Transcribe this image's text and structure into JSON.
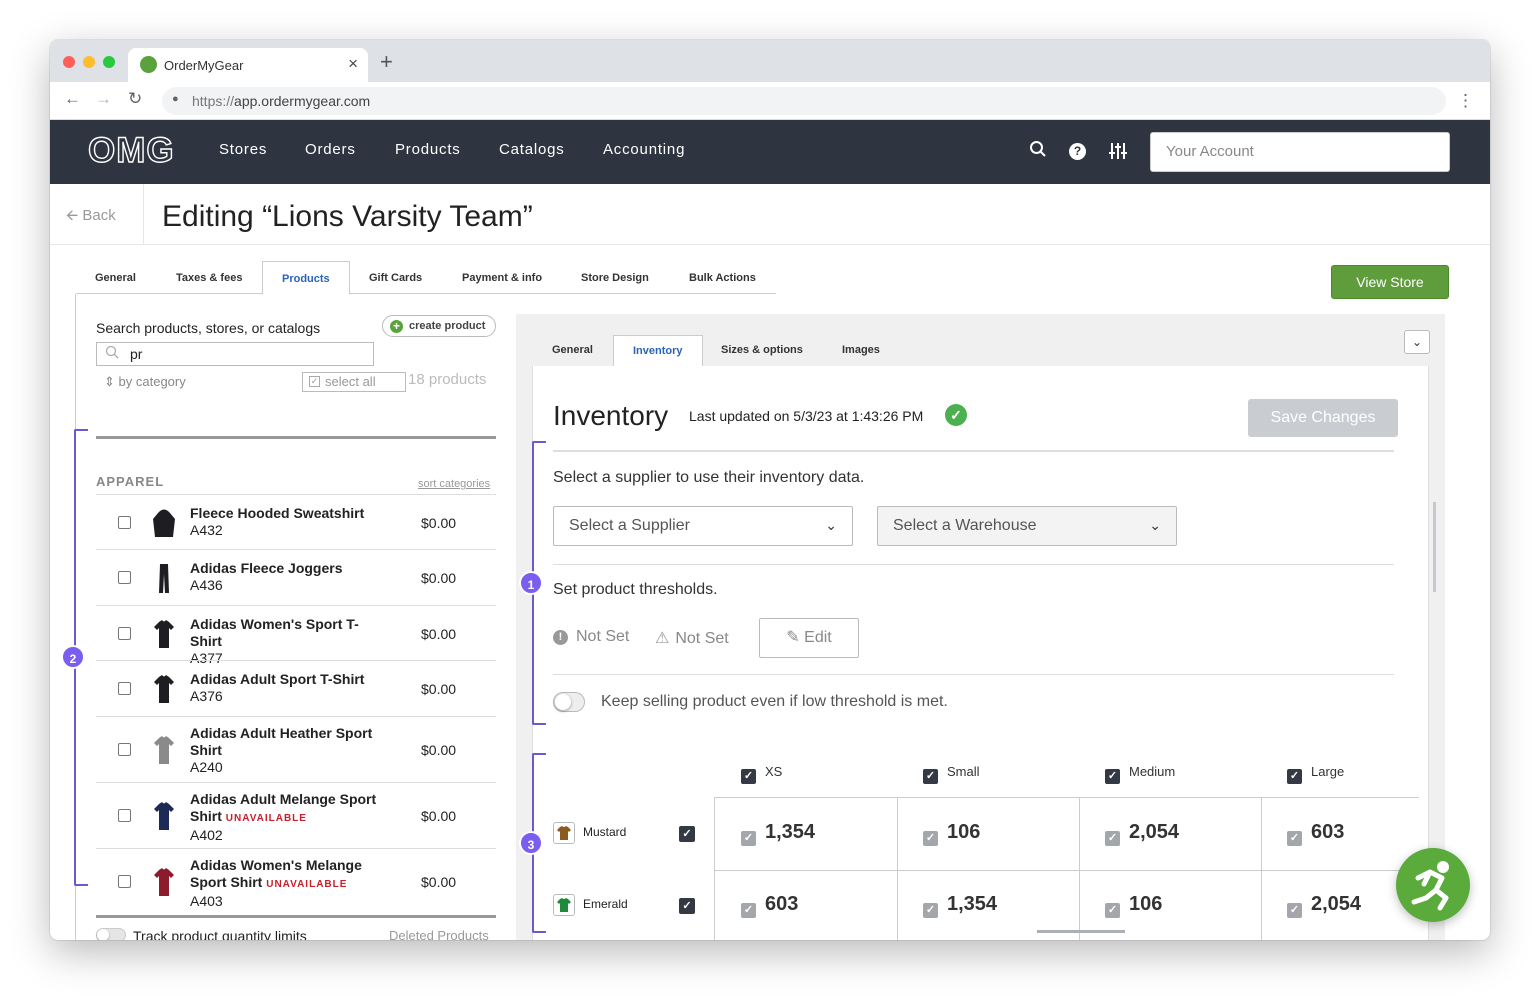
{
  "browser": {
    "tab_title": "OrderMyGear",
    "close_glyph": "×",
    "new_tab_glyph": "+",
    "url_scheme": "https://",
    "url_host": "app.ordermygear.com"
  },
  "header": {
    "logo": "OMG",
    "nav": [
      "Stores",
      "Orders",
      "Products",
      "Catalogs",
      "Accounting"
    ],
    "account_placeholder": "Your Account",
    "icons": [
      "search-icon",
      "help-icon",
      "sliders-icon"
    ]
  },
  "page": {
    "back_label": "Back",
    "title": "Editing “Lions Varsity Team”"
  },
  "main_tabs": [
    "General",
    "Taxes & fees",
    "Products",
    "Gift Cards",
    "Payment & info",
    "Store Design",
    "Bulk Actions"
  ],
  "main_tab_active": "Products",
  "view_store_label": "View Store",
  "left": {
    "search_label": "Search products, stores, or catalogs",
    "create_label": "create product",
    "search_value": "pr",
    "by_category": "by category",
    "select_all": "select all",
    "count": "18 products",
    "category": "APPAREL",
    "sort_link": "sort categories",
    "products": [
      {
        "name": "Fleece Hooded Sweatshirt",
        "sku": "A432",
        "price": "$0.00",
        "unavailable": "",
        "color": "#1e1e22"
      },
      {
        "name": "Adidas Fleece Joggers",
        "sku": "A436",
        "price": "$0.00",
        "unavailable": "",
        "color": "#1e1e22"
      },
      {
        "name": "Adidas Women's Sport T-Shirt",
        "sku": "A377",
        "price": "$0.00",
        "unavailable": "",
        "color": "#1e1e22"
      },
      {
        "name": "Adidas Adult Sport T-Shirt",
        "sku": "A376",
        "price": "$0.00",
        "unavailable": "",
        "color": "#1e1e22"
      },
      {
        "name": "Adidas Adult Heather Sport Shirt",
        "sku": "A240",
        "price": "$0.00",
        "unavailable": "",
        "color": "#8a8a8a"
      },
      {
        "name": "Adidas Adult Melange Sport Shirt",
        "sku": "A402",
        "price": "$0.00",
        "unavailable": "UNAVAILABLE",
        "color": "#1c2a55"
      },
      {
        "name": "Adidas Women's Melange Sport Shirt",
        "sku": "A403",
        "price": "$0.00",
        "unavailable": "UNAVAILABLE",
        "color": "#8c1c2c"
      }
    ],
    "track_label": "Track product quantity limits",
    "deleted_link": "Deleted Products"
  },
  "callouts": [
    "1",
    "2",
    "3"
  ],
  "product_tabs": [
    "General",
    "Inventory",
    "Sizes & options",
    "Images"
  ],
  "product_tab_active": "Inventory",
  "inventory": {
    "title": "Inventory",
    "last_updated": "Last updated on 5/3/23 at 1:43:26 PM",
    "save_label": "Save Changes",
    "supplier_prompt": "Select a supplier to use their inventory data.",
    "supplier_placeholder": "Select a Supplier",
    "warehouse_placeholder": "Select a Warehouse",
    "threshold_label": "Set product thresholds.",
    "threshold_low": "Not Set",
    "threshold_high": "Not Set",
    "edit_label": "Edit",
    "keep_selling": "Keep selling product even if low threshold is met.",
    "sizes": [
      "XS",
      "Small",
      "Medium",
      "Large"
    ],
    "rows": [
      {
        "color": "Mustard",
        "swatch": "#8a5a1e",
        "values": [
          "1,354",
          "106",
          "2,054",
          "603"
        ]
      },
      {
        "color": "Emerald",
        "swatch": "#1f8a3a",
        "values": [
          "603",
          "1,354",
          "106",
          "2,054"
        ]
      }
    ]
  },
  "colors": {
    "header_bg": "#2f3441",
    "accent_blue": "#2a64b4",
    "brand_green": "#5aab3c",
    "callout_purple": "#7b5df0",
    "unavailable_red": "#c8202a"
  }
}
